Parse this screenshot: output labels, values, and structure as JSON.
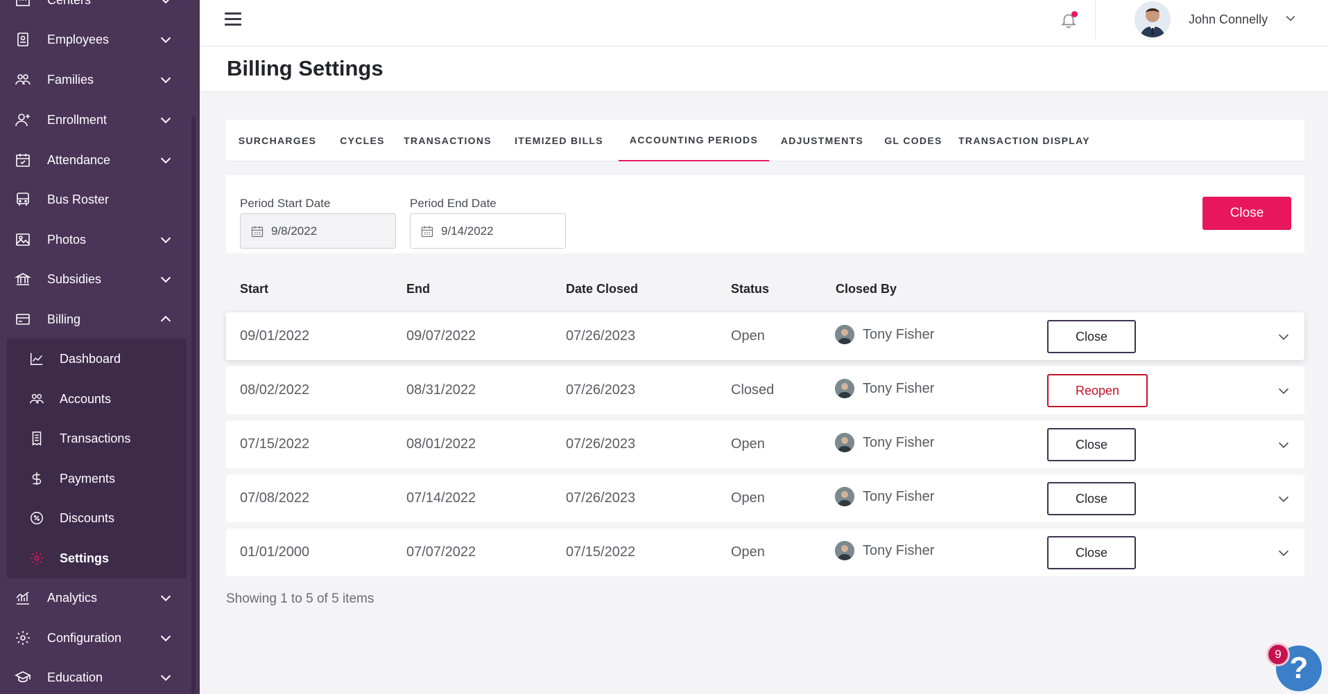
{
  "sidebar": {
    "items": [
      {
        "label": "Centers",
        "icon": "building-icon",
        "expandable": true
      },
      {
        "label": "Employees",
        "icon": "badge-icon",
        "expandable": true
      },
      {
        "label": "Families",
        "icon": "people-icon",
        "expandable": true
      },
      {
        "label": "Enrollment",
        "icon": "user-plus-icon",
        "expandable": true
      },
      {
        "label": "Attendance",
        "icon": "calendar-check-icon",
        "expandable": true
      },
      {
        "label": "Bus Roster",
        "icon": "bus-icon",
        "expandable": false
      },
      {
        "label": "Photos",
        "icon": "image-icon",
        "expandable": true
      },
      {
        "label": "Subsidies",
        "icon": "bank-icon",
        "expandable": true
      },
      {
        "label": "Billing",
        "icon": "credit-card-icon",
        "expandable": true,
        "expanded": true
      },
      {
        "label": "Analytics",
        "icon": "bar-chart-icon",
        "expandable": true
      },
      {
        "label": "Configuration",
        "icon": "gear-icon",
        "expandable": true
      },
      {
        "label": "Education",
        "icon": "graduation-cap-icon",
        "expandable": true
      }
    ],
    "billing_sub": [
      {
        "label": "Dashboard",
        "icon": "line-chart-icon"
      },
      {
        "label": "Accounts",
        "icon": "people-icon"
      },
      {
        "label": "Transactions",
        "icon": "receipt-icon"
      },
      {
        "label": "Payments",
        "icon": "dollar-icon"
      },
      {
        "label": "Discounts",
        "icon": "percent-icon"
      },
      {
        "label": "Settings",
        "icon": "gear-icon",
        "active": true
      }
    ]
  },
  "topbar": {
    "user_name": "John Connelly",
    "has_notification": true
  },
  "page": {
    "title": "Billing Settings"
  },
  "tabs": [
    {
      "label": "SURCHARGES"
    },
    {
      "label": "CYCLES"
    },
    {
      "label": "TRANSACTIONS"
    },
    {
      "label": "ITEMIZED BILLS"
    },
    {
      "label": "ACCOUNTING PERIODS",
      "active": true
    },
    {
      "label": "ADJUSTMENTS"
    },
    {
      "label": "GL CODES"
    },
    {
      "label": "TRANSACTION DISPLAY"
    }
  ],
  "filter": {
    "start_label": "Period Start Date",
    "start_value": "9/8/2022",
    "end_label": "Period End Date",
    "end_value": "9/14/2022",
    "close_label": "Close"
  },
  "table": {
    "headers": {
      "start": "Start",
      "end": "End",
      "date_closed": "Date Closed",
      "status": "Status",
      "closed_by": "Closed By"
    },
    "rows": [
      {
        "start": "09/01/2022",
        "end": "09/07/2022",
        "date_closed": "07/26/2023",
        "status": "Open",
        "closed_by": "Tony Fisher",
        "action": "Close"
      },
      {
        "start": "08/02/2022",
        "end": "08/31/2022",
        "date_closed": "07/26/2023",
        "status": "Closed",
        "closed_by": "Tony Fisher",
        "action": "Reopen"
      },
      {
        "start": "07/15/2022",
        "end": "08/01/2022",
        "date_closed": "07/26/2023",
        "status": "Open",
        "closed_by": "Tony Fisher",
        "action": "Close"
      },
      {
        "start": "07/08/2022",
        "end": "07/14/2022",
        "date_closed": "07/26/2023",
        "status": "Open",
        "closed_by": "Tony Fisher",
        "action": "Close"
      },
      {
        "start": "01/01/2000",
        "end": "07/07/2022",
        "date_closed": "07/15/2022",
        "status": "Open",
        "closed_by": "Tony Fisher",
        "action": "Close"
      }
    ],
    "footer": "Showing 1 to 5 of 5 items"
  },
  "help": {
    "badge_count": "9",
    "glyph": "?"
  },
  "colors": {
    "sidebar": "#4a3457",
    "accent": "#e8175d",
    "reopen": "#c4122a"
  }
}
